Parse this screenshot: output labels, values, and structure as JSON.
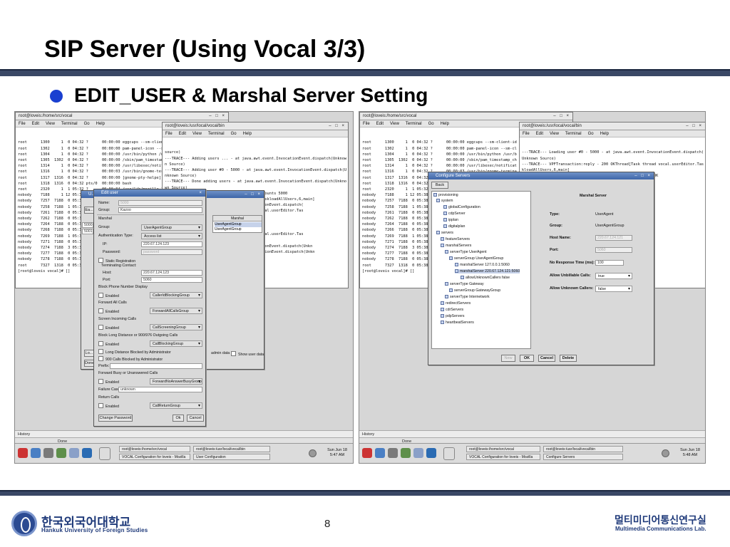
{
  "slide": {
    "title": "SIP Server (Using Vocal 3/3)",
    "subtitle": "EDIT_USER & Marshal Server Setting",
    "page_number": "8",
    "university_kr": "한국외국어대학교",
    "university_en": "Hankuk University of Foreign Studies",
    "lab_kr": "멀티미디어통신연구실",
    "lab_en": "Multimedia Communications Lab."
  },
  "left": {
    "term1": {
      "title": "root@loveis:/home/src/vocal",
      "menu": [
        "File",
        "Edit",
        "View",
        "Terminal",
        "Go",
        "Help"
      ],
      "lines": [
        "root      1300     1  0 04:32 ?      00:00:00 eggcups --sm-client-id",
        "root      1302     1  0 04:32 ?      00:00:00 pam-panel-icon --sm-cl",
        "root      1304     1  0 04:32 ?      00:00:00 /usr/bin/python /usr/b",
        "root      1305  1302  0 04:32 ?      00:00:00 /sbin/pam_timestamp_ch",
        "root      1314     1  0 04:32 ?      00:00:00 /usr/libexec/notificat",
        "root      1316     1  0 04:32 ?      00:00:03 /usr/bin/gnome-termina",
        "root      1317  1316  0 04:32 ?      00:00:00 [gnome-pty-helpe]",
        "root      1318  1316  0 04:32 pts/0  00:00:00 bash",
        "root      2320     1  1 05:32 ?      00:00:04 /usr/lib/mozilla-1.2.1",
        "nobody    7188     1 12 05:38 ?",
        "nobody    7257  7188  0 05:38 ?",
        "nobody    7258  7188  1 05:38 ?",
        "nobody    7261  7188  0 05:38 ?",
        "nobody    7262  7188  0 05:38 ?",
        "nobody    7264  7188  0 05:38 ?",
        "nobody    7268  7188  0 05:38 ?",
        "nobody    7269  7188  1 05:38 ?",
        "nobody    7271  7188  0 05:38 ?",
        "nobody    7274  7188  3 05:38 ?",
        "nobody    7277  7188  0 05:38 ?",
        "nobody    7278  7188  0 05:38 ?",
        "root      7327  1318  0 05:38 ?",
        "[root@loveis vocal]# []"
      ]
    },
    "term2": {
      "title": "root@loveis:/usr/local/vocal/bin",
      "menu": [
        "File",
        "Edit",
        "View",
        "Terminal",
        "Go",
        "Help"
      ],
      "lines": [
        "source)",
        "---TRACE--- Adding users ... - at java.awt.event.InvocationEvent.dispatch(Unknow",
        "n Source)",
        "---TRACE--- Adding user #0 - 5000 - at java.awt.event.InvocationEvent.dispatch(U",
        "nknown Source)",
        "---TRACE--- Done adding users - at java.awt.event.InvocationEvent.dispatch(Unkno",
        "wn Source)",
        "---TRACE--- VPFTransaction:request - GET Accounts 5000",
        "                         ...al.userEditor.TaskloadAllUsers,6,main]",
        "                         ...t.event.InvocationEvent.dispatch(",
        "",
        "                         ...[Task thread vocal.userEditor.Tas",
        "",
        "                         ...nLine = 200 OK",
        "                         ...ts 3001",
        "                         ...Users,6,main]",
        "                         ...[Task thread vocal.userEditor.Tas",
        "",
        "                         ...nLine = 200 OK",
        "                         ...t.event.InvocationEvent.dispatch(Unkn",
        "",
        "                         ...nt.event.InvocationEvent.dispatch(Unkn"
      ]
    },
    "under_table": {
      "header": "Marshal",
      "rows": [
        "UserAgentGroup",
        "UserAgentGroup"
      ],
      "footer": [
        "admin data",
        "Show user data"
      ]
    },
    "edit_user": {
      "title": "Edit user",
      "name_label": "Name:",
      "name_value": "5000",
      "group_label": "Group:",
      "group_value": "Kazoo",
      "marshal_label": "Marshal",
      "group2_label": "Group:",
      "group2_value": "UserAgentGroup",
      "auth_label": "Authentication Type:",
      "auth_value": "Access list",
      "ip_label": "IP:",
      "ip_value": "220.67.124.123",
      "password_label": "Password:",
      "password_value": "password",
      "static_reg": "Static Registration",
      "terminating_label": "Terminating Contact:",
      "host_label": "Host:",
      "host_value": "220.67.124.123",
      "port_label": "Port:",
      "port_value": "5060",
      "sections": [
        {
          "title": "Block Phone Number Display",
          "check": "Enabled",
          "combo": "CallerIdBlockingGroup"
        },
        {
          "title": "Forward All Calls",
          "check": "Enabled",
          "combo": "ForwardAllCallsGroup"
        },
        {
          "title": "Screen Incoming Calls",
          "check": "Enabled",
          "combo": "CallScreeningGroup"
        },
        {
          "title": "Block Long Distance or 900/976 Outgoing Calls",
          "check": "Enabled",
          "combo": "CallBlockingGroup"
        }
      ],
      "ld_blocked": "Long Distance Blocked by Administrator",
      "nine_blocked": "900 Calls Blocked by Administrator",
      "prefix_label": "Prefix:",
      "forward_busy": {
        "title": "Forward Busy or Unanswered Calls",
        "check": "Enabled",
        "combo": "ForwardNoAnswerBusyGroup"
      },
      "failure_label": "Failure Case:",
      "failure_value": "unknown",
      "return_calls": {
        "title": "Return Calls",
        "check": "Enabled",
        "combo": "CallReturnGroup"
      },
      "change_password": "Change Password",
      "ok": "Ok",
      "cancel": "Cancel"
    },
    "under_dialog_title": "U...",
    "under_buttons": [
      "Ea...",
      "Lo...",
      "Done"
    ],
    "under_list": [
      "5000",
      "5001"
    ],
    "history": "History",
    "status_done": "Done",
    "task_btns": [
      "root@loveis:/home/src/vocal",
      "root@loveis:/usr/local/vocal/bin",
      "VOCAL Configuration for loveis - Mozilla",
      "User Configuration"
    ],
    "clock_date": "Sun Jun 18",
    "clock_time": "5:47 AM"
  },
  "right": {
    "term1": {
      "title": "root@loveis:/home/src/vocal",
      "menu": [
        "File",
        "Edit",
        "View",
        "Terminal",
        "Go",
        "Help"
      ],
      "lines": [
        "root      1300     1  0 04:32 ?      00:00:00 eggcups --sm-client-id",
        "root      1302     1  0 04:32 ?      00:00:00 pam-panel-icon --sm-cl",
        "root      1304     1  0 04:32 ?      00:00:00 /usr/bin/python /usr/b",
        "root      1305  1302  0 04:32 ?      00:00:00 /sbin/pam_timestamp_ch",
        "root      1314     1  0 04:32 ?      00:00:00 /usr/libexec/notificat",
        "root      1316     1  0 04:32 ?      00:00:03 /usr/bin/gnome-termina",
        "root      1317  1316  0 04:32 ?",
        "root      1318  1316  0 04:32 pts/0",
        "root      2320     1  1 05:32 ?",
        "nobody    7188     1 12 05:38 ?",
        "nobody    7257  7188  0 05:38 ?",
        "nobody    7258  7188  1 05:38 ?",
        "nobody    7261  7188  0 05:38 ?",
        "nobody    7262  7188  0 05:38 ?",
        "nobody    7264  7188  0 05:38 ?",
        "nobody    7266  7188  0 05:38 ?",
        "nobody    7269  7188  1 05:38 ?",
        "nobody    7271  7188  0 05:38 ?",
        "nobody    7274  7188  3 05:38 ?",
        "nobody    7277  7188  0 05:38 ?",
        "nobody    7278  7188  0 05:38 ?",
        "root      7327  1318  0 05:38 ?",
        "[root@loveis vocal]# []"
      ]
    },
    "term2": {
      "title": "root@loveis:/usr/local/vocal/bin",
      "menu": [
        "File",
        "Edit",
        "View",
        "Terminal",
        "Go",
        "Help"
      ],
      "lines": [
        "---TRACE--- Loading user #0 - 5000 - at java.awt.event.InvocationEvent.dispatch(",
        "Unknown Source)",
        "---TRACE--- VPFTransaction:reply - 200 OKThread[Task thread vocal.userEditor.Tas",
        "kloadAllUsers,6,main]",
        "---TRACE--- VPFTransaction:sendRequest - statusLine = 200 OK",
        "",
        "                         ...vocal.userEditor.Tas",
        "",
        "                         ...OK",
        "                         ...nEvent.dispatch(Unkn",
        "",
        "                         ...se-0,6,main]",
        "                         ...OK",
        "                         ...se-0,6,main]",
        "                         ...OK"
      ]
    },
    "config": {
      "title": "Configure Servers",
      "back": "Back",
      "tree": [
        "provisioning",
        "system",
        "globalConfiguration",
        "cdpServer",
        "ipplan",
        "digitalplan",
        "servers",
        "featureServers",
        "marshalServers",
        "serverType UserAgent",
        "serverGroup UserAgentGroup",
        "marshalServer 127.0.0.1:5060",
        "marshalServer 220.67.124.121:5060",
        "allowUnknownCallers false",
        "serverType Gateway",
        "serverGroup GatewayGroup",
        "serverType Internetwork",
        "redirectServers",
        "cdrServers",
        "pdpServers",
        "heartbeatServers"
      ],
      "panel_title": "Marshal Server",
      "type_label": "Type:",
      "type_value": "UserAgent",
      "group_label": "Group:",
      "group_value": "UserAgentGroup",
      "host_label": "Host Name:",
      "host_value": "220.67.124.121",
      "port_label": "Port:",
      "port_value": "5060",
      "nrt_label": "No Response Time (ms):",
      "nrt_value": "100",
      "unbill_label": "Allow Unbillable Calls:",
      "unbill_value": "true",
      "unknown_label": "Allow Unknown Callers:",
      "unknown_value": "false",
      "buttons": [
        "New",
        "OK",
        "Cancel",
        "Delete"
      ]
    },
    "history": "History",
    "status_done": "Done",
    "task_btns": [
      "root@loveis:/home/src/vocal",
      "root@loveis:/usr/local/vocal/bin",
      "VOCAL Configuration for loveis - Mozilla",
      "Configure Servers"
    ],
    "clock_date": "Sun Jun 18",
    "clock_time": "5:48 AM"
  }
}
